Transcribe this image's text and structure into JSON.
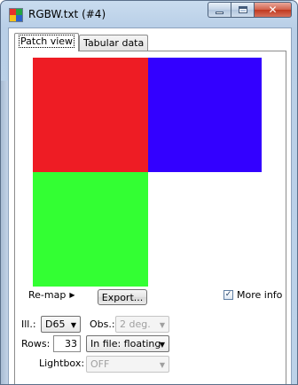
{
  "window": {
    "title": "RGBW.txt (#4)",
    "icon": "app-color-squares-icon"
  },
  "tabs": [
    {
      "label": "Patch view",
      "active": true
    },
    {
      "label": "Tabular data",
      "active": false
    }
  ],
  "patches": [
    {
      "name": "red",
      "color": "#ee1c24"
    },
    {
      "name": "blue",
      "color": "#3300ff"
    },
    {
      "name": "green",
      "color": "#33ff33"
    }
  ],
  "controls": {
    "remap_label": "Re-map",
    "export_label": "Export...",
    "more_info_label": "More info",
    "more_info_checked": true,
    "illuminant_label": "Ill.:",
    "illuminant_value": "D65",
    "observer_label": "Obs.:",
    "observer_value": "2 deg.",
    "rows_label": "Rows:",
    "rows_value": "33",
    "infile_value": "In file: floating",
    "lightbox_label": "Lightbox:",
    "lightbox_value": "OFF"
  }
}
